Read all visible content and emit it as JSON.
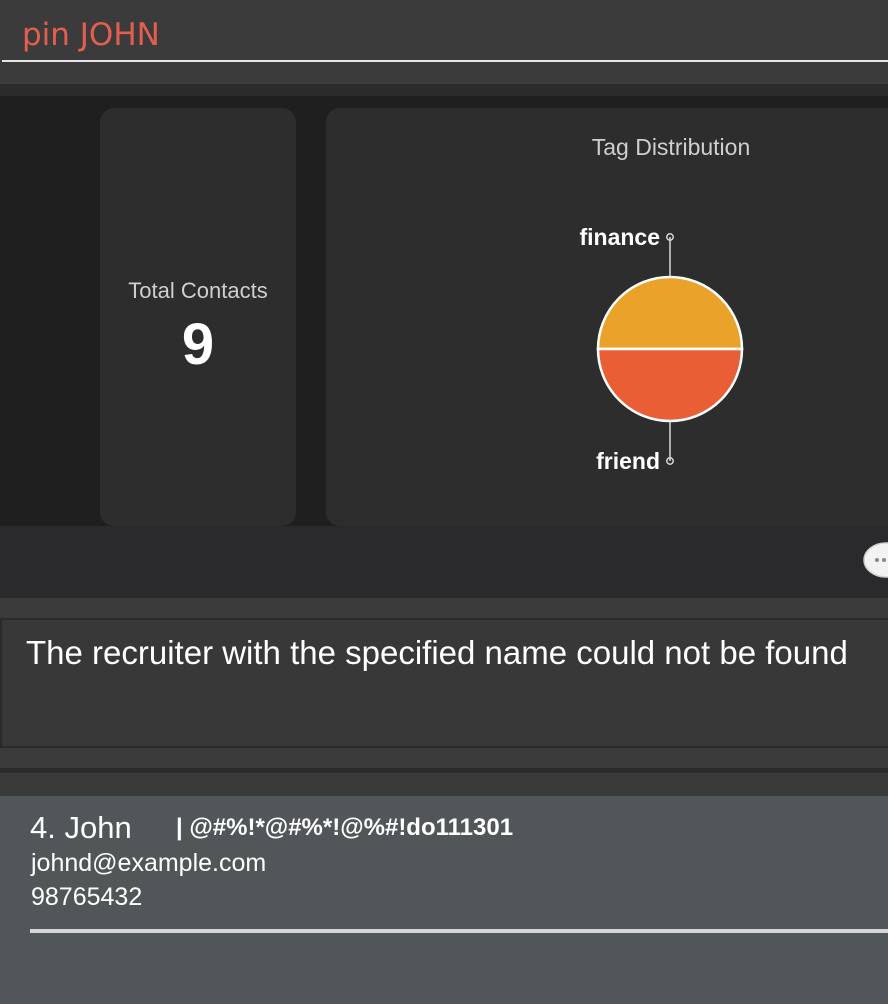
{
  "command_box": {
    "value": "pin JOHN"
  },
  "stats": {
    "total_label": "Total Contacts",
    "total_value": "9"
  },
  "tag_chart": {
    "title": "Tag Distribution"
  },
  "chart_data": {
    "type": "pie",
    "title": "Tag Distribution",
    "categories": [
      "finance",
      "friend"
    ],
    "values": [
      50,
      50
    ],
    "colors": [
      "#eba22a",
      "#ea5e35"
    ],
    "legend": "labels-with-leader-lines"
  },
  "toolbar": {
    "chat_icon": "speech-bubble-icon"
  },
  "result_display": {
    "message": "The recruiter with the specified name could not be found"
  },
  "person_list": {
    "items": [
      {
        "name": "4. John",
        "tags": "| @#%!*@#%*!@%#!do111301",
        "email": "johnd@example.com",
        "phone": "98765432"
      }
    ]
  }
}
